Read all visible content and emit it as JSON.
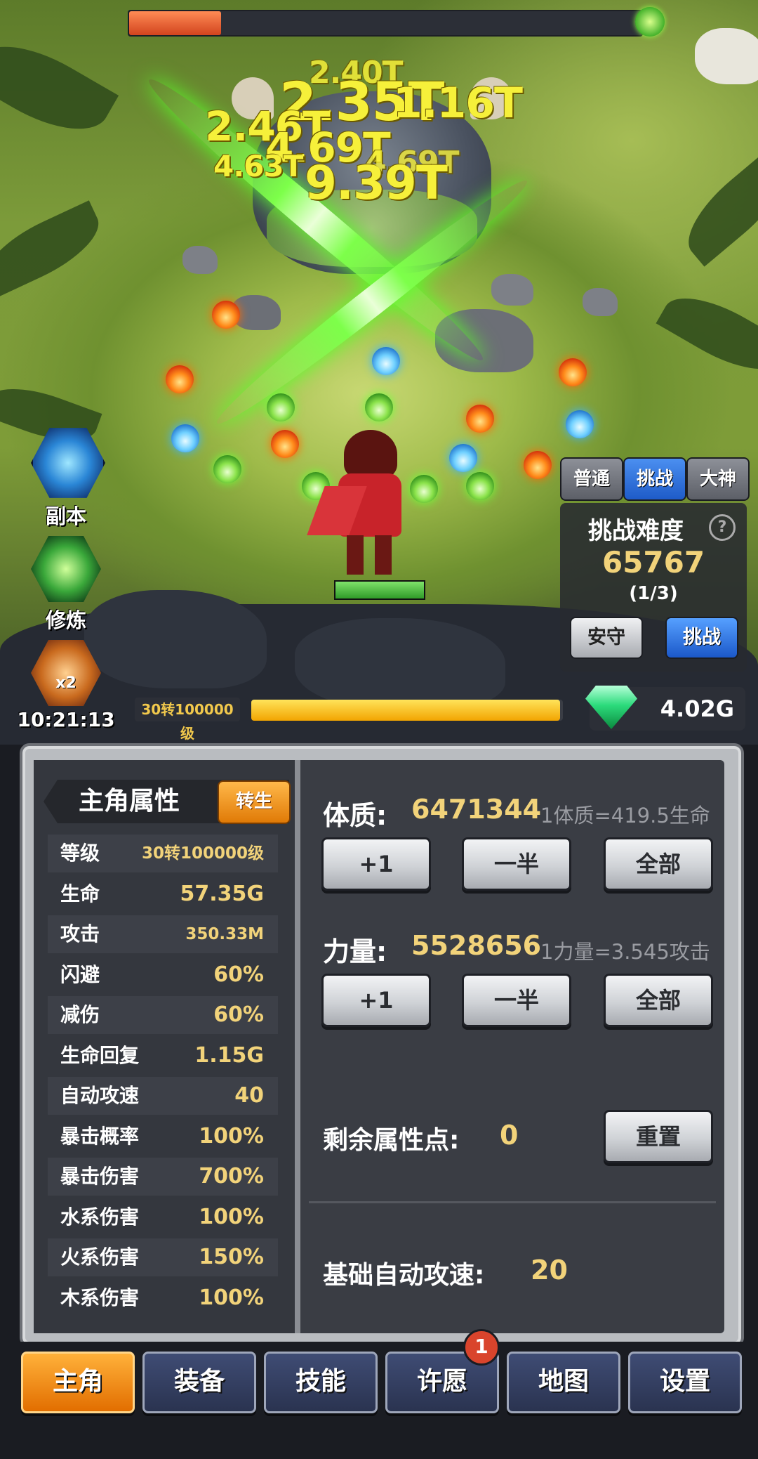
{
  "damage_numbers": [
    "2.35T",
    "2.40T",
    "1.16T",
    "2.46T",
    "4.69T",
    "4.63T",
    "4.69T",
    "9.39T"
  ],
  "side_menu": {
    "dungeon_label": "副本",
    "cultivate_label": "修炼",
    "boost_label": "x2",
    "boost_timer": "10:21:13"
  },
  "mode_tabs": [
    "普通",
    "挑战",
    "大神"
  ],
  "difficulty": {
    "title": "挑战难度",
    "help": "?",
    "value": "65767",
    "progress": "(1/3)",
    "guard_label": "安守",
    "challenge_label": "挑战"
  },
  "level_bar": {
    "label": "30转100000级",
    "progress": 0.99
  },
  "currency": {
    "gems": "4.02G"
  },
  "boss_hp_fraction": 0.18,
  "hero_panel": {
    "title": "主角属性",
    "rebirth_label": "转生",
    "stats": [
      {
        "name": "等级",
        "value": "30转100000级"
      },
      {
        "name": "生命",
        "value": "57.35G"
      },
      {
        "name": "攻击",
        "value": "350.33M"
      },
      {
        "name": "闪避",
        "value": "60%"
      },
      {
        "name": "减伤",
        "value": "60%"
      },
      {
        "name": "生命回复",
        "value": "1.15G"
      },
      {
        "name": "自动攻速",
        "value": "40"
      },
      {
        "name": "暴击概率",
        "value": "100%"
      },
      {
        "name": "暴击伤害",
        "value": "700%"
      },
      {
        "name": "水系伤害",
        "value": "100%"
      },
      {
        "name": "火系伤害",
        "value": "150%"
      },
      {
        "name": "木系伤害",
        "value": "100%"
      }
    ]
  },
  "attributes": {
    "constitution": {
      "label": "体质:",
      "value": "6471344",
      "note": "1体质=419.5生命"
    },
    "strength": {
      "label": "力量:",
      "value": "5528656",
      "note": "1力量=3.545攻击"
    },
    "buttons": {
      "plus_one": "+1",
      "half": "一半",
      "all": "全部"
    },
    "remaining_label": "剩余属性点:",
    "remaining_value": "0",
    "reset_label": "重置",
    "base_speed_label": "基础自动攻速:",
    "base_speed_value": "20"
  },
  "bottom_tabs": [
    "主角",
    "装备",
    "技能",
    "许愿",
    "地图",
    "设置"
  ],
  "wish_badge": "1"
}
